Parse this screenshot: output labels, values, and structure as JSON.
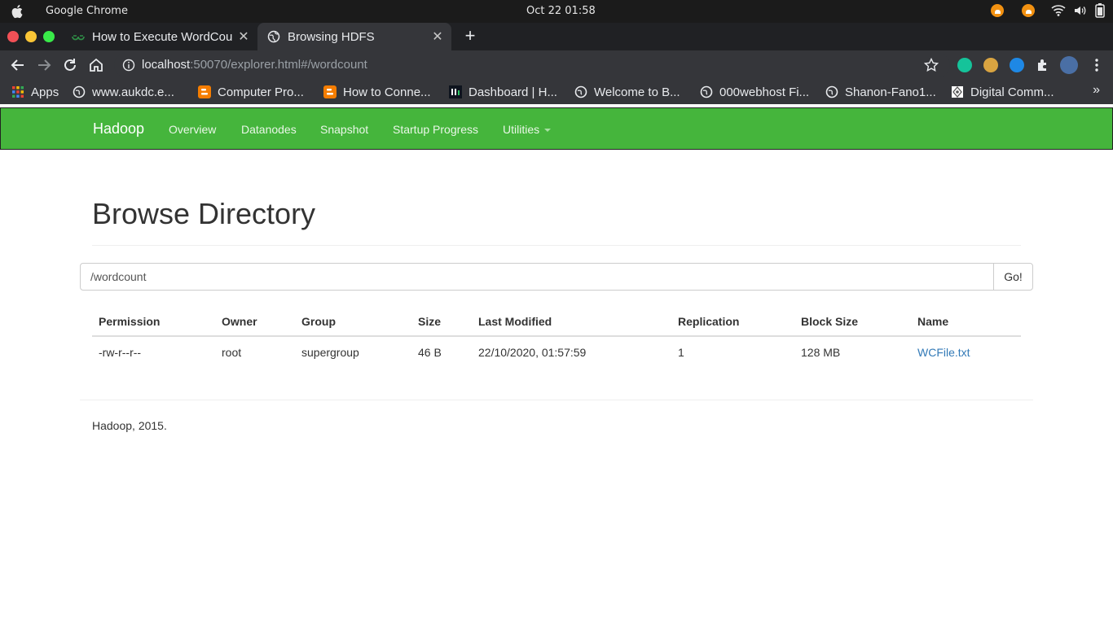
{
  "os": {
    "app_name": "Google Chrome",
    "clock": "Oct 22  01:58"
  },
  "tabs": [
    {
      "title": "How to Execute WordCou",
      "active": false
    },
    {
      "title": "Browsing HDFS",
      "active": true
    }
  ],
  "toolbar": {
    "url_host": "localhost",
    "url_rest": ":50070/explorer.html#/wordcount"
  },
  "bookmarks": [
    {
      "label": "Apps",
      "icon": "apps-grid-icon"
    },
    {
      "label": "www.aukdc.e...",
      "icon": "globe-icon"
    },
    {
      "label": "Computer Pro...",
      "icon": "blogger-icon"
    },
    {
      "label": "How to Conne...",
      "icon": "blogger-icon"
    },
    {
      "label": "Dashboard | H...",
      "icon": "hackerrank-icon"
    },
    {
      "label": "Welcome to B...",
      "icon": "globe-icon"
    },
    {
      "label": "000webhost Fi...",
      "icon": "globe-icon"
    },
    {
      "label": "Shanon-Fano1...",
      "icon": "globe-icon"
    },
    {
      "label": "Digital Comm...",
      "icon": "site-icon"
    }
  ],
  "hadoop": {
    "brand": "Hadoop",
    "nav": [
      "Overview",
      "Datanodes",
      "Snapshot",
      "Startup Progress",
      "Utilities"
    ],
    "page_title": "Browse Directory",
    "path_value": "/wordcount",
    "go_label": "Go!",
    "table": {
      "headers": [
        "Permission",
        "Owner",
        "Group",
        "Size",
        "Last Modified",
        "Replication",
        "Block Size",
        "Name"
      ],
      "rows": [
        [
          "-rw-r--r--",
          "root",
          "supergroup",
          "46 B",
          "22/10/2020, 01:57:59",
          "1",
          "128 MB",
          "WCFile.txt"
        ]
      ]
    },
    "footer": "Hadoop, 2015."
  },
  "colors": {
    "navbar": "#45b53c",
    "link": "#337ab7",
    "chrome_dark": "#202124",
    "chrome_toolbar": "#35363a"
  }
}
